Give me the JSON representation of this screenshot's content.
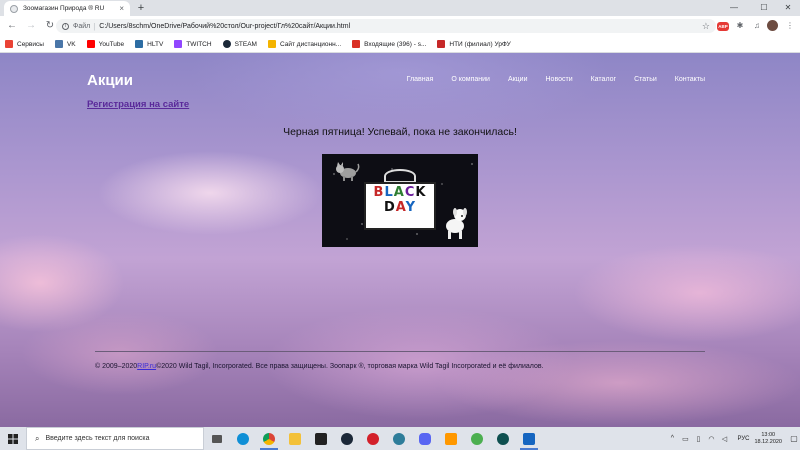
{
  "browser": {
    "tab": {
      "title": "Зоомагазин Природа ® RU",
      "close": "×"
    },
    "new_tab": "+",
    "window": {
      "minimize": "—",
      "maximize": "☐",
      "close": "✕"
    },
    "nav": {
      "back": "←",
      "forward": "→",
      "reload": "↻"
    },
    "omnibox": {
      "scheme": "Файл",
      "separator": "|",
      "url": "C:/Users/8schm/OneDrive/Рабочий%20стол/Our-project/Гл%20сайт/Акции.html"
    },
    "extensions": {
      "abp": "ABP"
    }
  },
  "bookmarks": [
    {
      "label": "Сервисы",
      "color": "#ea4335"
    },
    {
      "label": "VK",
      "color": "#4a76a8"
    },
    {
      "label": "YouTube",
      "color": "#ff0000"
    },
    {
      "label": "HLTV",
      "color": "#2d6da3"
    },
    {
      "label": "TWITCH",
      "color": "#9146ff"
    },
    {
      "label": "STEAM",
      "color": "#1b2838"
    },
    {
      "label": "Сайт дистанционн...",
      "color": "#f4b400"
    },
    {
      "label": "Входящие (396) - s...",
      "color": "#d93025"
    },
    {
      "label": "НТИ (филиал) УрФУ",
      "color": "#c62828"
    }
  ],
  "page": {
    "title": "Акции",
    "nav": [
      "Главная",
      "О компании",
      "Акции",
      "Новости",
      "Каталог",
      "Статьи",
      "Контакты"
    ],
    "registration_link": "Регистрация на сайте",
    "promo_text": "Черная пятница! Успевай, пока не закончилась!",
    "banner": {
      "line1": "BLACK",
      "line2": "DAY"
    },
    "footer": {
      "prefix": "© 2009–2020",
      "link": "RIP.ru",
      "suffix": "©2020 Wild Tagil, Incorporated. Все права защищены. Зоопарк ®, торговая марка Wild Tagil Incorporated и её филиалов."
    }
  },
  "taskbar": {
    "search_placeholder": "Введите здесь текст для поиска",
    "apps": [
      {
        "name": "task-view",
        "color": "#555555",
        "active": false
      },
      {
        "name": "edge",
        "color": "#0f8fd6",
        "active": false
      },
      {
        "name": "chrome",
        "color": "#dd4b39",
        "active": true
      },
      {
        "name": "explorer",
        "color": "#f3c13a",
        "active": false
      },
      {
        "name": "notion",
        "color": "#222222",
        "active": false
      },
      {
        "name": "steam",
        "color": "#1b2838",
        "active": false
      },
      {
        "name": "opera",
        "color": "#d3202a",
        "active": false
      },
      {
        "name": "app-circle",
        "color": "#2e7d9a",
        "active": false
      },
      {
        "name": "discord",
        "color": "#5865f2",
        "active": false
      },
      {
        "name": "sublime",
        "color": "#ff9800",
        "active": false
      },
      {
        "name": "utorrent",
        "color": "#4caf50",
        "active": false
      },
      {
        "name": "app-teal",
        "color": "#0e4f4f",
        "active": false
      },
      {
        "name": "app-blue",
        "color": "#1565c0",
        "active": true
      }
    ],
    "tray": {
      "lang": "РУС",
      "time": "13:00",
      "date": "18.12.2020"
    }
  }
}
